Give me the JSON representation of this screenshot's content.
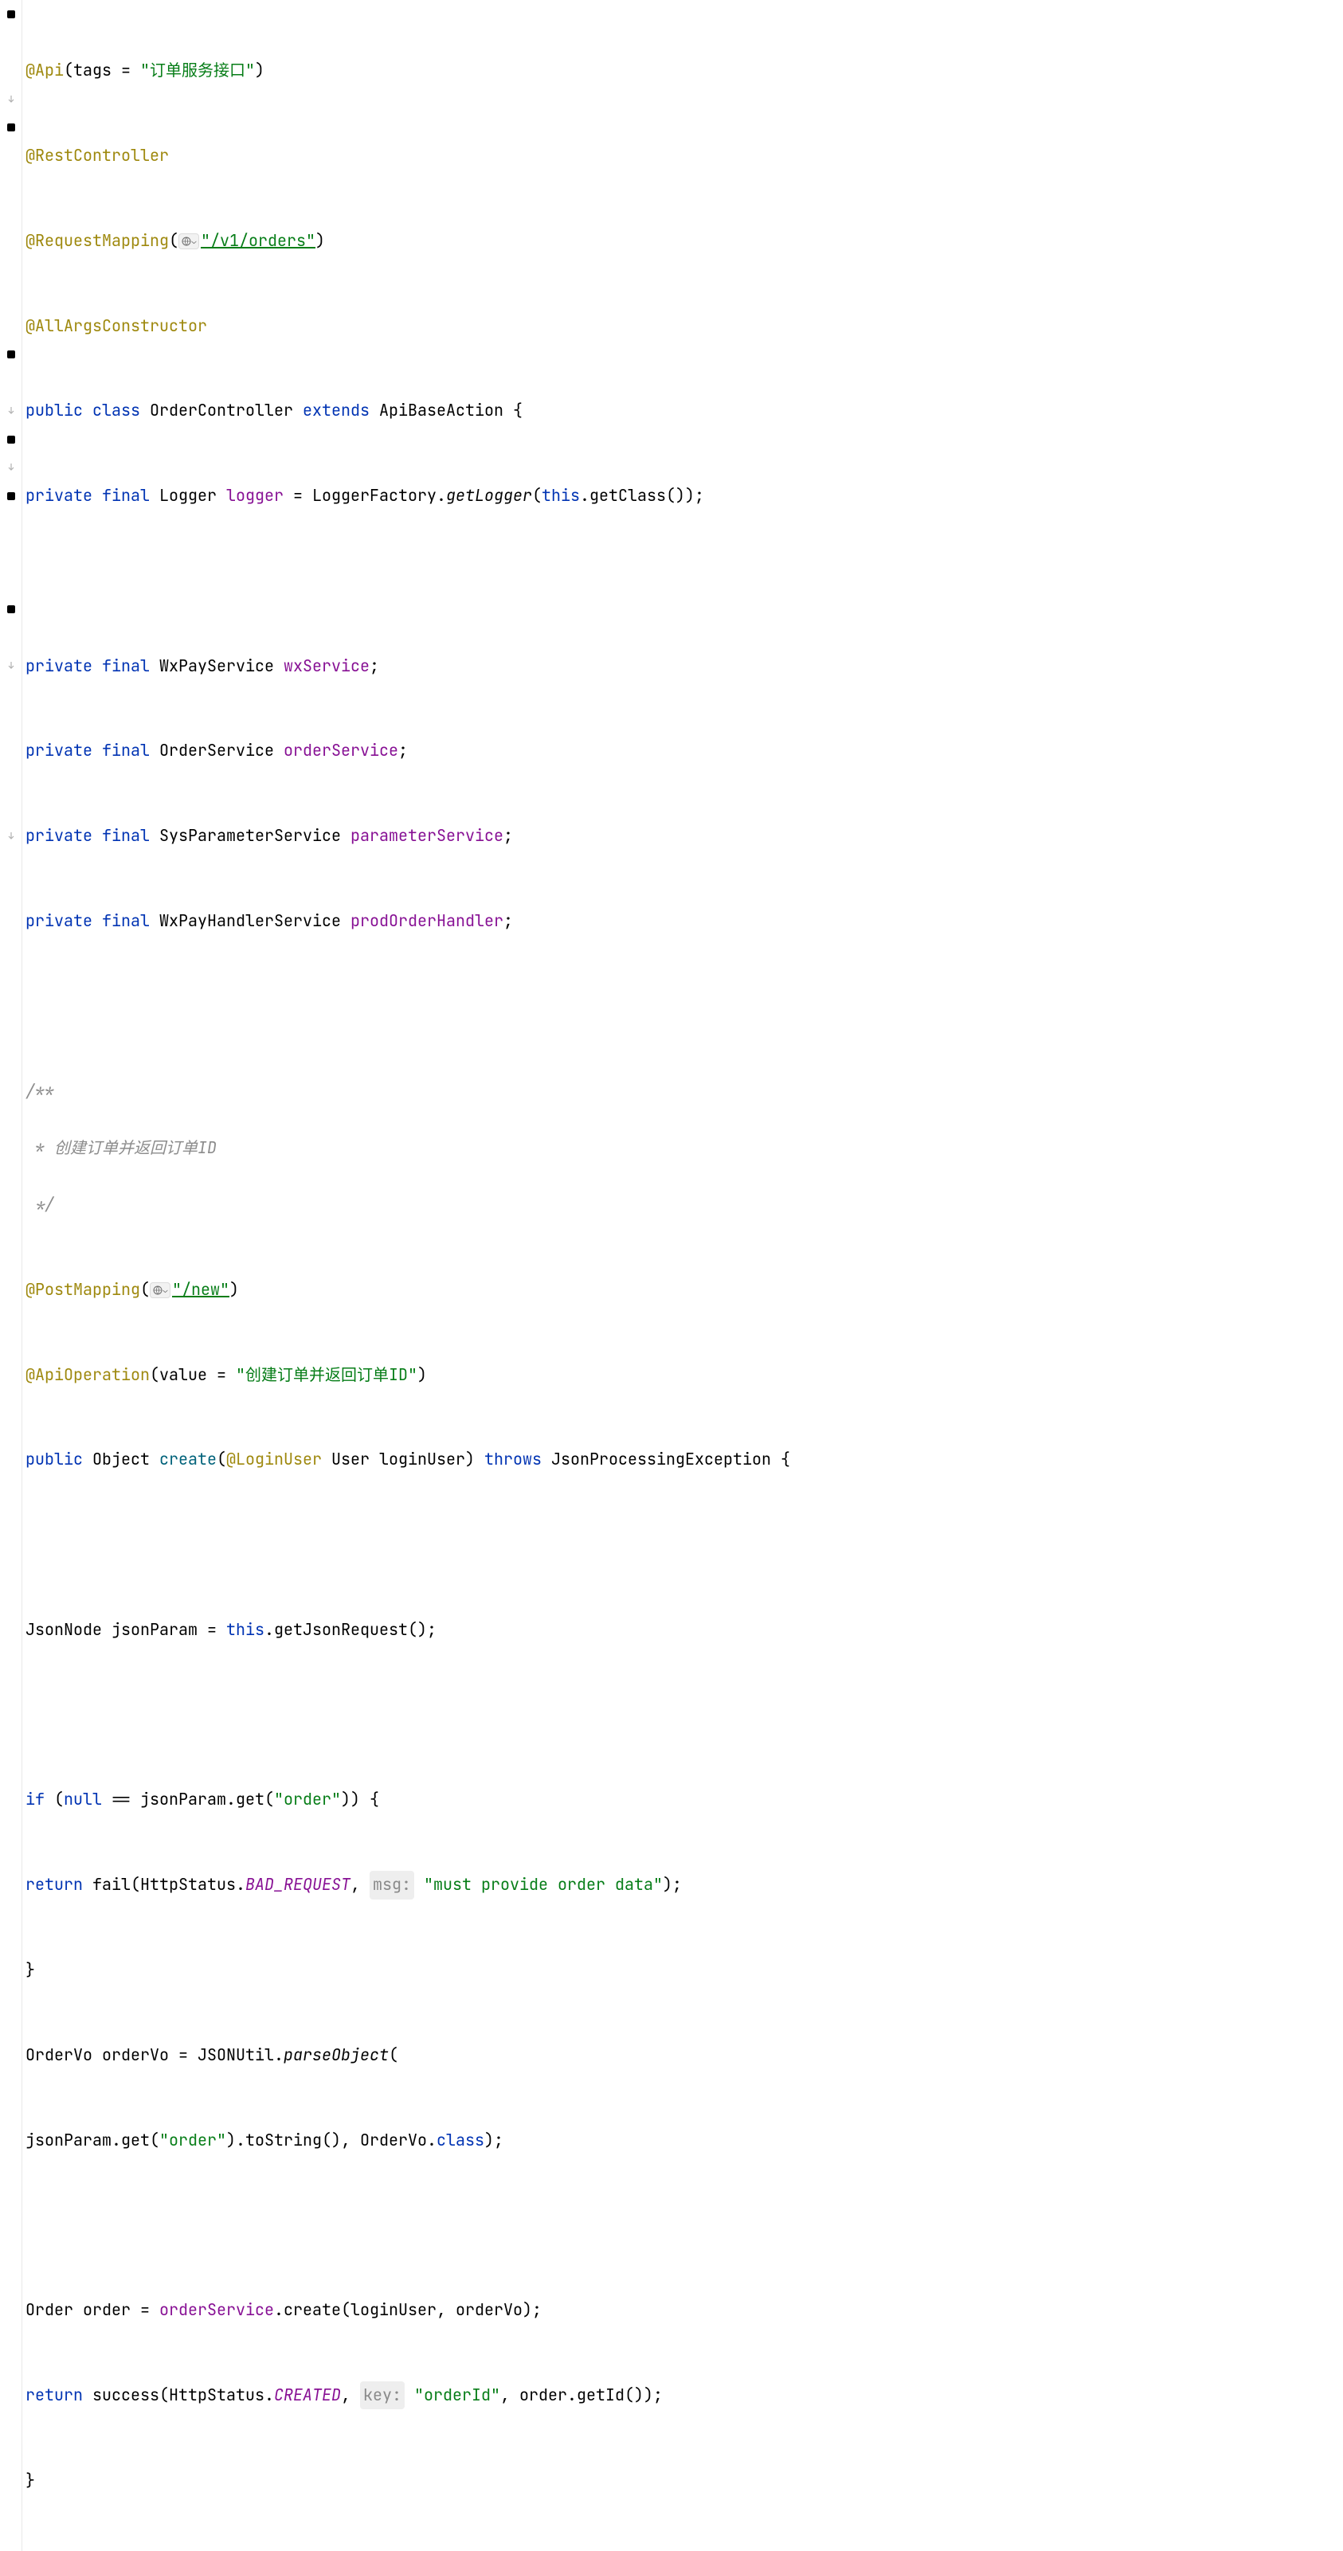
{
  "lines": {
    "l1": {
      "ann": "@Api",
      "p1": "(tags = ",
      "s": "\"订单服务接口\"",
      "p2": ")"
    },
    "l2": {
      "ann": "@RestController"
    },
    "l3": {
      "ann": "@RequestMapping",
      "p1": "(",
      "s": "\"/v1/orders\"",
      "p2": ")"
    },
    "l4": {
      "ann": "@AllArgsConstructor"
    },
    "l5": {
      "k1": "public class ",
      "t": "OrderController ",
      "k2": "extends ",
      "t2": "ApiBaseAction {"
    },
    "l6": {
      "k": "private final ",
      "ty": "Logger ",
      "f": "logger",
      "eq": " = LoggerFactory.",
      "m": "getLogger",
      "p": "(",
      "k2": "this",
      "rest": ".getClass());"
    },
    "l7": {
      "blank": " "
    },
    "l8": {
      "k": "private final ",
      "ty": "WxPayService ",
      "f": "wxService",
      "semi": ";"
    },
    "l9": {
      "k": "private final ",
      "ty": "OrderService ",
      "f": "orderService",
      "semi": ";"
    },
    "l10": {
      "k": "private final ",
      "ty": "SysParameterService ",
      "f": "parameterService",
      "semi": ";"
    },
    "l11": {
      "k": "private final ",
      "ty": "WxPayHandlerService ",
      "f": "prodOrderHandler",
      "semi": ";"
    },
    "l12": {
      "blank": " "
    },
    "l13": {
      "c": "/**"
    },
    "l14": {
      "c": " * 创建订单并返回订单ID"
    },
    "l15": {
      "c": " */"
    },
    "l16": {
      "ann": "@PostMapping",
      "p1": "(",
      "s": "\"/new\"",
      "p2": ")"
    },
    "l17": {
      "ann": "@ApiOperation",
      "p1": "(value = ",
      "s": "\"创建订单并返回订单ID\"",
      "p2": ")"
    },
    "l18": {
      "k1": "public ",
      "ty": "Object ",
      "m": "create",
      "p1": "(",
      "ann": "@LoginUser",
      "p2": " User loginUser) ",
      "k2": "throws ",
      "ex": "JsonProcessingException {"
    },
    "l19": {
      "blank": " "
    },
    "l20": {
      "pre": "JsonNode jsonParam = ",
      "k": "this",
      "rest": ".getJsonRequest();"
    },
    "l21": {
      "blank": " "
    },
    "l22": {
      "k": "if ",
      "p1": "(",
      "k2": "null ",
      "rest": "== jsonParam.get(",
      "s": "\"order\"",
      "p2": ")) {"
    },
    "l23": {
      "k": "return ",
      "call": "fail(HttpStatus.",
      "sf": "BAD_REQUEST",
      "comma": ", ",
      "hint": "msg:",
      "sp": " ",
      "s": "\"must provide order data\"",
      "p2": ");"
    },
    "l24": {
      "brace": "}"
    },
    "l25": {
      "pre": "OrderVo orderVo = JSONUtil.",
      "m": "parseObject",
      "p": "("
    },
    "l26": {
      "pre": "jsonParam.get(",
      "s": "\"order\"",
      "mid": ").toString(), OrderVo.",
      "k": "class",
      "p2": ");"
    },
    "l27": {
      "blank": " "
    },
    "l28": {
      "pre": "Order order = ",
      "f": "orderService",
      "rest": ".create(loginUser, orderVo);"
    },
    "l29": {
      "k": "return ",
      "call": "success(HttpStatus.",
      "sf": "CREATED",
      "comma": ", ",
      "hint": "key:",
      "sp": " ",
      "s": "\"orderId\"",
      "rest": ", order.getId());"
    },
    "l30": {
      "brace": "}"
    }
  },
  "gutter_icons": [
    "fold-minus",
    "",
    "",
    "fold-end",
    "fold-minus",
    "",
    "",
    "",
    "",
    "",
    "",
    "",
    "fold-minus",
    "",
    "fold-end",
    "fold-minus",
    "fold-end",
    "fold-minus",
    "",
    "",
    "",
    "fold-minus",
    "",
    "fold-end",
    "",
    "",
    "",
    "",
    "",
    "fold-end"
  ]
}
